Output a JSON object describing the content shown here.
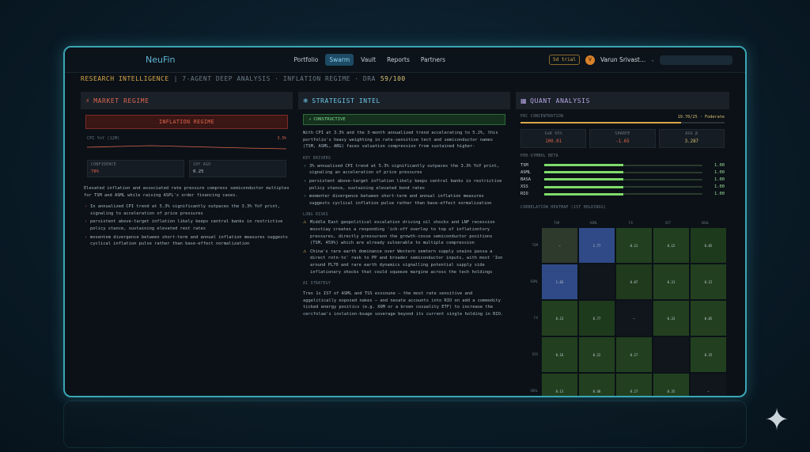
{
  "nav": {
    "brand": "NeuFin",
    "links": [
      "Portfolio",
      "Swarm",
      "Vault",
      "Reports",
      "Partners"
    ],
    "active": "Swarm",
    "trial": "5d trial",
    "avatar_initial": "V",
    "username": "Varun Srivast…"
  },
  "title": {
    "main": "RESEARCH INTELLIGENCE",
    "sub": "| 7-AGENT DEEP ANALYSIS · INFLATION REGIME · DRA",
    "dra_score": "59/100"
  },
  "market": {
    "header": "MARKET REGIME",
    "regime_label": "INFLATION REGIME",
    "cpi_label": "CPI YoY (12M)",
    "cpi_value": "3.3%",
    "confidence_label": "CONFIDENCE",
    "confidence_value": "78%",
    "tenyr_label": "10Y AGO",
    "tenyr_value": "0.25",
    "summary": "Elevated inflation and associated rate pressure compress semiconductor multiples for TSM and ASML while raising ASPL's order financing cases.",
    "bullets": [
      "In annualized CPI trend at 5.3% significantly outpaces the 3.3% YoY print, signaling to acceleration of price pressures",
      "persistent above-target inflation likely keeps central banks in restrictive policy stance, sustaining elevated rest rates",
      "mosentem divergence between short-term and annual inflation measures suggests cyclical inflation pulse rather than base-effect normalization"
    ]
  },
  "strategist": {
    "header": "STRATEGIST INTEL",
    "stance": "CONSTRUCTIVE",
    "intro": "With CPI at 3.3% and the 3-month annualized trend accelerating to 5.2%, this portfolio's heavy weighting in rate-sensitive tect and semiconductor names (TSM, ASML, ARG) faces valuation compression from sustained higher-",
    "key_drivers_label": "KEY DRIVERS",
    "drivers": [
      "3% annualised CPI trend at 5.3% significantly outpaces the 3.3% YoY print, signaling an acceleration of price pressures",
      "persistent above-target inflation likely keeps central banks in restrictive policy stance, sustaining elevated bond rates",
      "momenter divergence between short-term and annual inflation measures suggests cyclical inflation pulse rather than base-effect normalization"
    ],
    "risks_label": "LONG RISKS",
    "risks": [
      "Middle East geopolitical escalation driving oil shocks and LNF recession mosstiay creates a responding 'ich-off overlay to top of inflationtory pressures, directly pressureon the growth-cosse semiconductor positions (TSM, 459%) which are already vulnerable to multiple compression",
      "China's rare earth dominance over Western semtern supply snains passa a direct rotn-to' rask to PP and broader semiconductor inputs, with most 'Ion around PL70 and rare earth dynamics signalling potential supply side inflationary shocks that could squeeze margine across the tech holdings"
    ],
    "strategy_label": "AI STRATEGY",
    "strategy": "Tres 1s IST of ASML and TSS esssoune — the most rate sensitive and aggelitically exposed nakes — and nesate accounts into RIO on add a commodity ticked energy positics (e.g. XOM or a broen cosuality ETF) to increase the cercfolae's invlation-bsage soverage beyond its current single holding in RIO."
  },
  "quant": {
    "header": "QUANT ANALYSIS",
    "pfc_label": "PRC CONCENTRATION",
    "pfc_value": "19.70/25 · Foderate",
    "pfc_fraction": 0.788,
    "metrics": [
      {
        "label": "VaR 95%",
        "value": "100.01",
        "tone": "red"
      },
      {
        "label": "SHARPE",
        "value": "-1.65",
        "tone": "red"
      },
      {
        "label": "AVG β",
        "value": "3.287",
        "tone": "yel"
      }
    ],
    "beta_label": "PER-SYMBOL BETA",
    "betas": [
      {
        "ticker": "TSM",
        "value": "1.00",
        "fraction": 0.5
      },
      {
        "ticker": "ASML",
        "value": "1.00",
        "fraction": 0.5
      },
      {
        "ticker": "BASA",
        "value": "1.00",
        "fraction": 0.5
      },
      {
        "ticker": "XSS",
        "value": "1.00",
        "fraction": 0.5
      },
      {
        "ticker": "RIO",
        "value": "1.00",
        "fraction": 0.5
      }
    ],
    "heatmap_label": "CORRELATION HEATMAP (1ST HOLDINGS)",
    "heat_cols": [
      "TSM",
      "ASML",
      "FX",
      "VIT",
      "SOXL"
    ],
    "heat_rows": [
      "TSM",
      "ASML",
      "FX",
      "VIX",
      "SOXL"
    ],
    "heat_vals": [
      [
        "—",
        "1.77",
        "0.21",
        "0.15",
        "0.05"
      ],
      [
        "1.03",
        "",
        "0.07",
        "0.31",
        "0.15"
      ],
      [
        "0.23",
        "0.77",
        "—",
        "0.33",
        "0.05"
      ],
      [
        "0.16",
        "0.22",
        "0.27",
        "",
        "0.35"
      ],
      [
        "0.13",
        "0.40",
        "0.27",
        "0.35",
        "—"
      ]
    ],
    "heat_colors": [
      [
        "#2e3a2c",
        "#2f4a86",
        "#22401f",
        "#22401f",
        "#1e3a1c"
      ],
      [
        "#2f4a86",
        "#10161b",
        "#1f3a1c",
        "#22401f",
        "#22401f"
      ],
      [
        "#22401f",
        "#1e3a1c",
        "#10161b",
        "#22401f",
        "#22401f"
      ],
      [
        "#22401f",
        "#22401f",
        "#22401f",
        "#10161b",
        "#22401f"
      ],
      [
        "#22401f",
        "#22401f",
        "#22401f",
        "#22401f",
        "#10161b"
      ]
    ]
  }
}
